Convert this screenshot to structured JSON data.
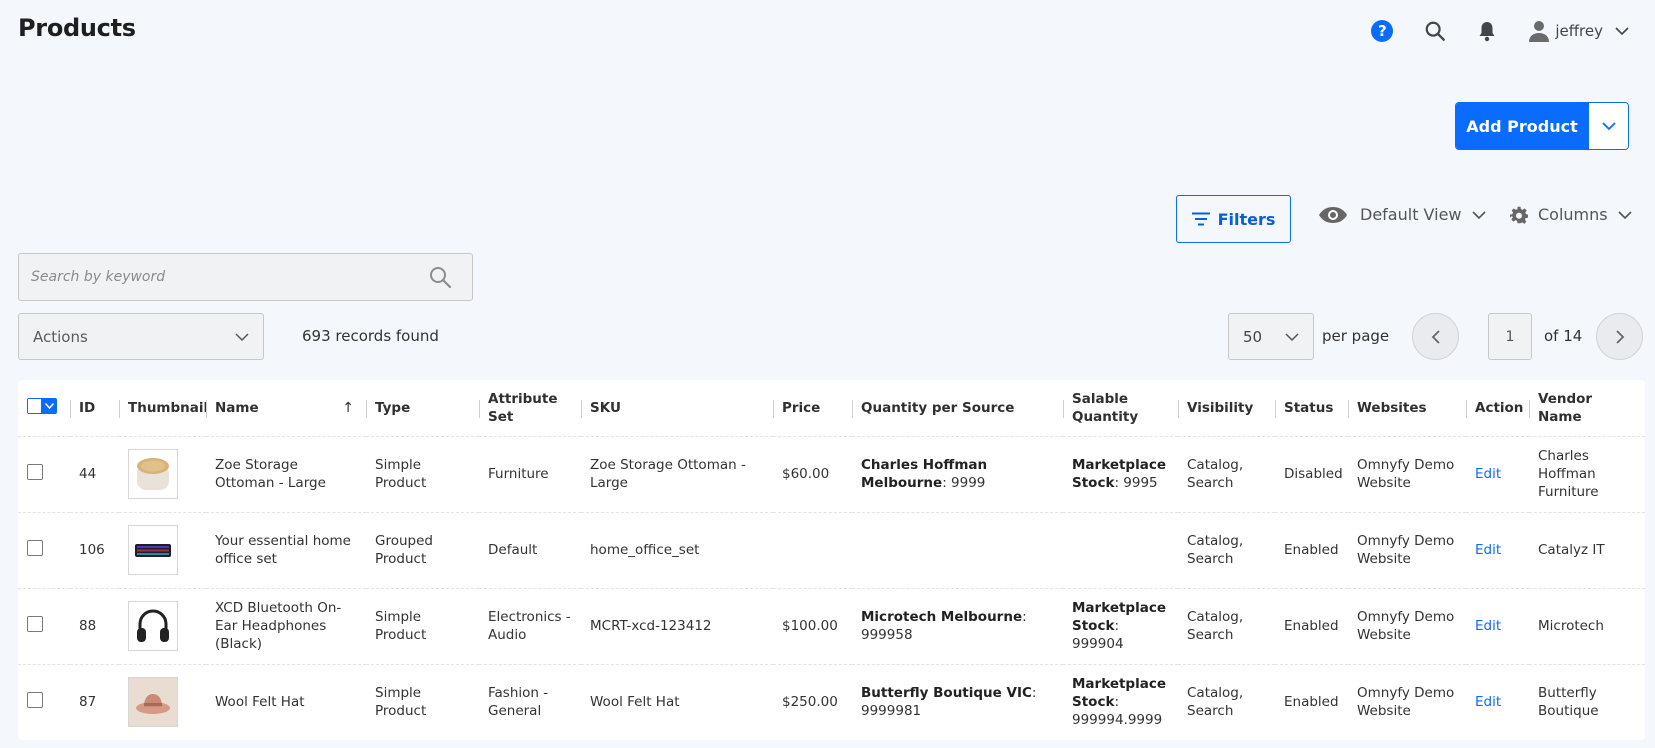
{
  "header": {
    "title": "Products",
    "user": "jeffrey",
    "help_glyph": "?"
  },
  "add_product": {
    "label": "Add Product"
  },
  "toolbar": {
    "filters_label": "Filters",
    "view_label": "Default View",
    "columns_label": "Columns"
  },
  "search": {
    "placeholder": "Search by keyword"
  },
  "actions": {
    "label": "Actions"
  },
  "records_found": "693 records found",
  "pagination": {
    "per_page_value": "50",
    "per_page_label": "per page",
    "current_page": "1",
    "total_pages_label": "of 14"
  },
  "table": {
    "columns": [
      "ID",
      "Thumbnail",
      "Name",
      "Type",
      "Attribute Set",
      "SKU",
      "Price",
      "Quantity per Source",
      "Salable Quantity",
      "Visibility",
      "Status",
      "Websites",
      "Action",
      "Vendor Name"
    ],
    "sort_arrow": "↑",
    "rows": [
      {
        "id": "44",
        "thumbnail": "ottoman-thumbnail",
        "name": "Zoe Storage Ottoman - Large",
        "type": "Simple Product",
        "attribute_set": "Furniture",
        "sku": "Zoe Storage Ottoman - Large",
        "price": "$60.00",
        "qps_source": "Charles Hoffman Melbourne",
        "qps_qty": ": 9999",
        "salable_source": "Marketplace Stock",
        "salable_qty": ": 9995",
        "visibility": "Catalog, Search",
        "status": "Disabled",
        "websites": "Omnyfy Demo Website",
        "action": "Edit",
        "vendor": "Charles Hoffman Furniture"
      },
      {
        "id": "106",
        "thumbnail": "keyboard-thumbnail",
        "name": "Your essential home office set",
        "type": "Grouped Product",
        "attribute_set": "Default",
        "sku": "home_office_set",
        "price": "",
        "qps_source": "",
        "qps_qty": "",
        "salable_source": "",
        "salable_qty": "",
        "visibility": "Catalog, Search",
        "status": "Enabled",
        "websites": "Omnyfy Demo Website",
        "action": "Edit",
        "vendor": "Catalyz IT"
      },
      {
        "id": "88",
        "thumbnail": "headphones-thumbnail",
        "name": "XCD Bluetooth On-Ear Headphones (Black)",
        "type": "Simple Product",
        "attribute_set": "Electronics - Audio",
        "sku": "MCRT-xcd-123412",
        "price": "$100.00",
        "qps_source": "Microtech Melbourne",
        "qps_qty": ": 999958",
        "salable_source": "Marketplace Stock",
        "salable_qty": ": 999904",
        "visibility": "Catalog, Search",
        "status": "Enabled",
        "websites": "Omnyfy Demo Website",
        "action": "Edit",
        "vendor": "Microtech"
      },
      {
        "id": "87",
        "thumbnail": "hat-thumbnail",
        "name": "Wool Felt Hat",
        "type": "Simple Product",
        "attribute_set": "Fashion - General",
        "sku": "Wool Felt Hat",
        "price": "$250.00",
        "qps_source": "Butterfly Boutique VIC",
        "qps_qty": ": 9999981",
        "salable_source": "Marketplace Stock",
        "salable_qty": ": 999994.9999",
        "visibility": "Catalog, Search",
        "status": "Enabled",
        "websites": "Omnyfy Demo Website",
        "action": "Edit",
        "vendor": "Butterfly Boutique"
      }
    ]
  }
}
